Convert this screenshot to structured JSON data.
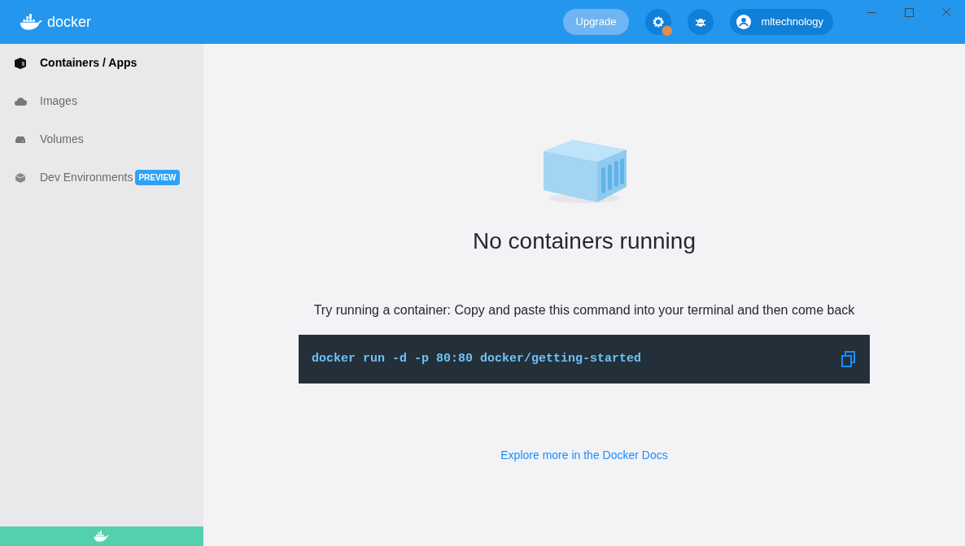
{
  "header": {
    "logo": "docker",
    "upgrade": "Upgrade",
    "settings_alert": true,
    "user": "mltechnology"
  },
  "sidebar": {
    "items": [
      {
        "kind": "containers",
        "label": "Containers / Apps",
        "selected": true
      },
      {
        "kind": "images",
        "label": "Images",
        "selected": false
      },
      {
        "kind": "volumes",
        "label": "Volumes",
        "selected": false
      },
      {
        "kind": "dev",
        "label": "Dev Environments",
        "selected": false,
        "badge": "PREVIEW"
      }
    ]
  },
  "main": {
    "title": "No containers running",
    "hint": "Try running a container: Copy and paste this command into your terminal and then come back",
    "command": "docker run -d -p 80:80 docker/getting-started",
    "link": "Explore more in the Docker Docs"
  }
}
